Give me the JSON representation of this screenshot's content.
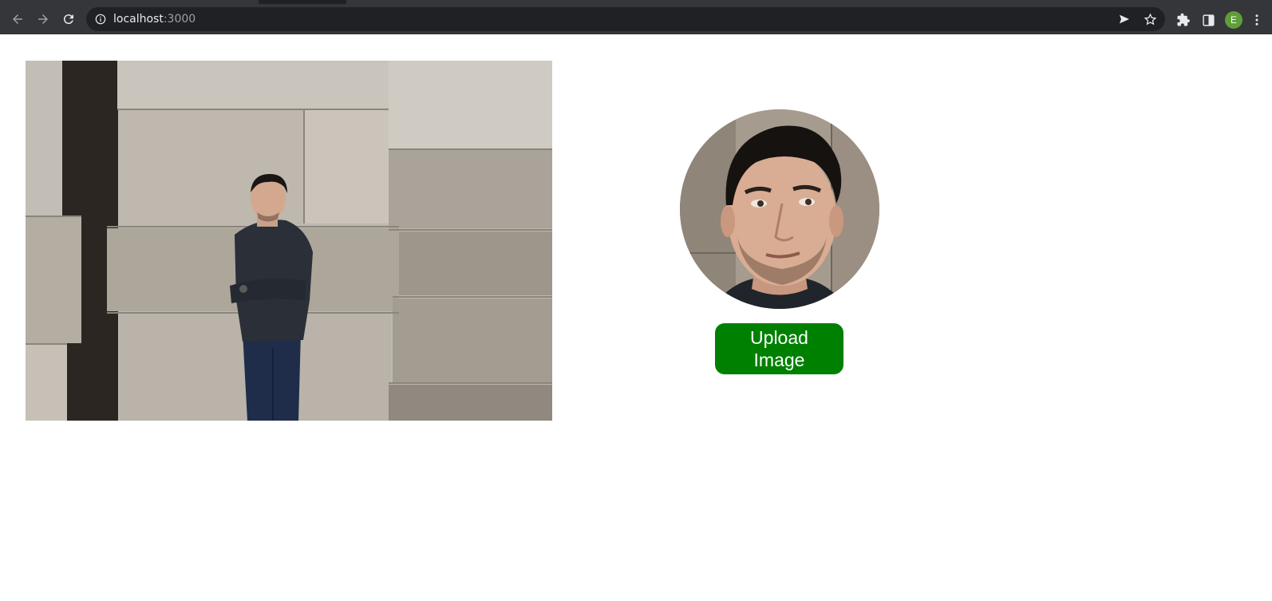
{
  "browser": {
    "url_host": "localhost",
    "url_port": ":3000",
    "profile_initial": "E",
    "icons": [
      "back-arrow-icon",
      "forward-arrow-icon",
      "reload-icon",
      "info-icon",
      "send-icon",
      "star-icon",
      "extensions-icon",
      "side-panel-icon",
      "kebab-menu-icon"
    ]
  },
  "main": {
    "upload_button_label": "Upload Image"
  },
  "colors": {
    "upload_button": "#008000",
    "chrome_toolbar": "#35363a",
    "omnibox": "#202124",
    "profile_avatar": "#5e9e37"
  }
}
